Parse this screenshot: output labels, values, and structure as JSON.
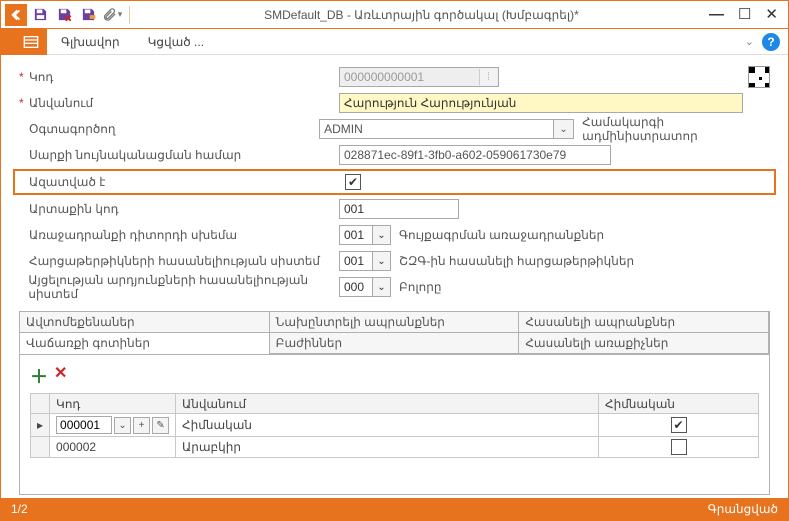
{
  "titlebar": {
    "title": "SMDefault_DB - Առևտրային գործակալ (Խմբագրել)*"
  },
  "menubar": {
    "items": [
      "Գլխավոր",
      "Կցված ..."
    ]
  },
  "form": {
    "code": {
      "label": "Կոդ",
      "placeholder": "000000000001",
      "required": true
    },
    "name": {
      "label": "Անվանում",
      "value": "Հարություն Հարությունյան",
      "required": true
    },
    "user": {
      "label": "Օգտագործող",
      "value": "ADMIN",
      "hint": "Համակարգի ադմինիստրատոր"
    },
    "serial": {
      "label": "Սարքի նույնականացման համար",
      "value": "028871ec-89f1-3fb0-a602-059061730e79"
    },
    "active": {
      "label": "Ազատված է",
      "checked": true
    },
    "extcode": {
      "label": "Արտաքին կոդ",
      "value": "001"
    },
    "offerSys": {
      "label": "Առաջադրանքի դիտորդի սխեմա",
      "value": "001",
      "desc": "Գույքագրման առաջադրանքներ"
    },
    "surveySys": {
      "label": "Հարցաթերթիկների հասանելիության սիստեմ",
      "value": "001",
      "desc": "ՇԶԳ-ին հասանելի հարցաթերթիկներ"
    },
    "visitSys": {
      "label": "Այցելության արդյունքների հասանելիության սիստեմ",
      "value": "000",
      "desc": "Բոլորը"
    }
  },
  "tabs": {
    "row1": [
      "Ավտոմեքենաներ",
      "Նախընտրելի ապրանքներ",
      "Հասանելի ապրանքներ"
    ],
    "row2": [
      "Վաճառքի գոտիներ",
      "Բաժիններ",
      "Հասանելի առաքիչներ"
    ],
    "active": "Վաճառքի գոտիներ"
  },
  "grid": {
    "headers": {
      "code": "Կոդ",
      "name": "Անվանում",
      "main": "Հիմնական"
    },
    "rows": [
      {
        "code": "000001",
        "name": "Հիմնական",
        "main": true,
        "selected": true
      },
      {
        "code": "000002",
        "name": "Արաբկիր",
        "main": false,
        "selected": false
      }
    ]
  },
  "status": {
    "left": "1/2",
    "right": "Գրանցված"
  }
}
